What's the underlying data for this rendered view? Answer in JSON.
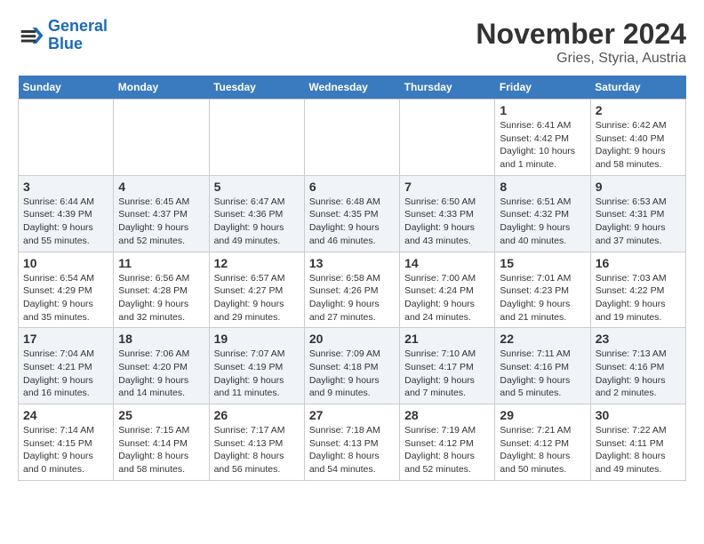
{
  "logo": {
    "line1": "General",
    "line2": "Blue"
  },
  "title": "November 2024",
  "subtitle": "Gries, Styria, Austria",
  "days_of_week": [
    "Sunday",
    "Monday",
    "Tuesday",
    "Wednesday",
    "Thursday",
    "Friday",
    "Saturday"
  ],
  "weeks": [
    [
      {
        "day": "",
        "info": ""
      },
      {
        "day": "",
        "info": ""
      },
      {
        "day": "",
        "info": ""
      },
      {
        "day": "",
        "info": ""
      },
      {
        "day": "",
        "info": ""
      },
      {
        "day": "1",
        "info": "Sunrise: 6:41 AM\nSunset: 4:42 PM\nDaylight: 10 hours and 1 minute."
      },
      {
        "day": "2",
        "info": "Sunrise: 6:42 AM\nSunset: 4:40 PM\nDaylight: 9 hours and 58 minutes."
      }
    ],
    [
      {
        "day": "3",
        "info": "Sunrise: 6:44 AM\nSunset: 4:39 PM\nDaylight: 9 hours and 55 minutes."
      },
      {
        "day": "4",
        "info": "Sunrise: 6:45 AM\nSunset: 4:37 PM\nDaylight: 9 hours and 52 minutes."
      },
      {
        "day": "5",
        "info": "Sunrise: 6:47 AM\nSunset: 4:36 PM\nDaylight: 9 hours and 49 minutes."
      },
      {
        "day": "6",
        "info": "Sunrise: 6:48 AM\nSunset: 4:35 PM\nDaylight: 9 hours and 46 minutes."
      },
      {
        "day": "7",
        "info": "Sunrise: 6:50 AM\nSunset: 4:33 PM\nDaylight: 9 hours and 43 minutes."
      },
      {
        "day": "8",
        "info": "Sunrise: 6:51 AM\nSunset: 4:32 PM\nDaylight: 9 hours and 40 minutes."
      },
      {
        "day": "9",
        "info": "Sunrise: 6:53 AM\nSunset: 4:31 PM\nDaylight: 9 hours and 37 minutes."
      }
    ],
    [
      {
        "day": "10",
        "info": "Sunrise: 6:54 AM\nSunset: 4:29 PM\nDaylight: 9 hours and 35 minutes."
      },
      {
        "day": "11",
        "info": "Sunrise: 6:56 AM\nSunset: 4:28 PM\nDaylight: 9 hours and 32 minutes."
      },
      {
        "day": "12",
        "info": "Sunrise: 6:57 AM\nSunset: 4:27 PM\nDaylight: 9 hours and 29 minutes."
      },
      {
        "day": "13",
        "info": "Sunrise: 6:58 AM\nSunset: 4:26 PM\nDaylight: 9 hours and 27 minutes."
      },
      {
        "day": "14",
        "info": "Sunrise: 7:00 AM\nSunset: 4:24 PM\nDaylight: 9 hours and 24 minutes."
      },
      {
        "day": "15",
        "info": "Sunrise: 7:01 AM\nSunset: 4:23 PM\nDaylight: 9 hours and 21 minutes."
      },
      {
        "day": "16",
        "info": "Sunrise: 7:03 AM\nSunset: 4:22 PM\nDaylight: 9 hours and 19 minutes."
      }
    ],
    [
      {
        "day": "17",
        "info": "Sunrise: 7:04 AM\nSunset: 4:21 PM\nDaylight: 9 hours and 16 minutes."
      },
      {
        "day": "18",
        "info": "Sunrise: 7:06 AM\nSunset: 4:20 PM\nDaylight: 9 hours and 14 minutes."
      },
      {
        "day": "19",
        "info": "Sunrise: 7:07 AM\nSunset: 4:19 PM\nDaylight: 9 hours and 11 minutes."
      },
      {
        "day": "20",
        "info": "Sunrise: 7:09 AM\nSunset: 4:18 PM\nDaylight: 9 hours and 9 minutes."
      },
      {
        "day": "21",
        "info": "Sunrise: 7:10 AM\nSunset: 4:17 PM\nDaylight: 9 hours and 7 minutes."
      },
      {
        "day": "22",
        "info": "Sunrise: 7:11 AM\nSunset: 4:16 PM\nDaylight: 9 hours and 5 minutes."
      },
      {
        "day": "23",
        "info": "Sunrise: 7:13 AM\nSunset: 4:16 PM\nDaylight: 9 hours and 2 minutes."
      }
    ],
    [
      {
        "day": "24",
        "info": "Sunrise: 7:14 AM\nSunset: 4:15 PM\nDaylight: 9 hours and 0 minutes."
      },
      {
        "day": "25",
        "info": "Sunrise: 7:15 AM\nSunset: 4:14 PM\nDaylight: 8 hours and 58 minutes."
      },
      {
        "day": "26",
        "info": "Sunrise: 7:17 AM\nSunset: 4:13 PM\nDaylight: 8 hours and 56 minutes."
      },
      {
        "day": "27",
        "info": "Sunrise: 7:18 AM\nSunset: 4:13 PM\nDaylight: 8 hours and 54 minutes."
      },
      {
        "day": "28",
        "info": "Sunrise: 7:19 AM\nSunset: 4:12 PM\nDaylight: 8 hours and 52 minutes."
      },
      {
        "day": "29",
        "info": "Sunrise: 7:21 AM\nSunset: 4:12 PM\nDaylight: 8 hours and 50 minutes."
      },
      {
        "day": "30",
        "info": "Sunrise: 7:22 AM\nSunset: 4:11 PM\nDaylight: 8 hours and 49 minutes."
      }
    ]
  ]
}
